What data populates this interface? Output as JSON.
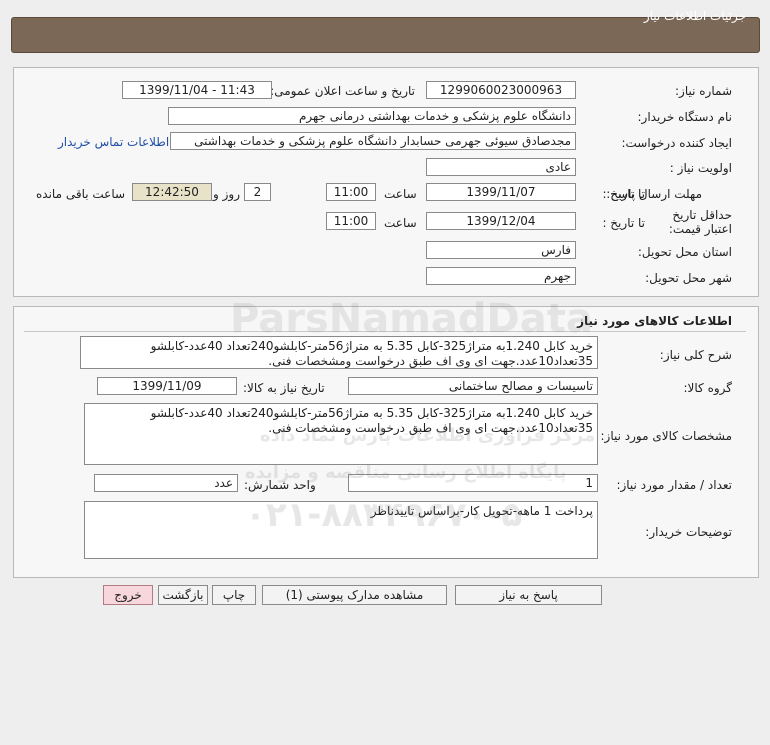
{
  "header": {
    "title": "جزئیات اطلاعات نیاز"
  },
  "details": {
    "need_number_label": "شماره نیاز:",
    "need_number": "1299060023000963",
    "announce_label": "تاریخ و ساعت اعلان عمومی:",
    "announce_value": "1399/11/04 - 11:43",
    "buyer_org_label": "نام دستگاه خریدار:",
    "buyer_org": "دانشگاه علوم پزشکی و خدمات بهداشتی درمانی جهرم",
    "requester_label": "ایجاد کننده درخواست:",
    "requester": "مجدصادق  سیوئی جهرمی حسابدار دانشگاه علوم پزشکی و خدمات بهداشتی",
    "contact_link": "اطلاعات تماس خریدار",
    "priority_label": "اولویت نیاز :",
    "priority": "عادی",
    "reply_deadline_label": "مهلت ارسال پاسخ:",
    "to_date_label": "تا تاریخ :",
    "reply_date": "1399/11/07",
    "time_label": "ساعت",
    "reply_time": "11:00",
    "days_value": "2",
    "days_label": "روز و",
    "remaining_time": "12:42:50",
    "remaining_label": "ساعت باقی مانده",
    "price_validity_label": "حداقل تاریخ اعتبار قیمت:",
    "price_to_date_label": "تا تاریخ :",
    "price_date": "1399/12/04",
    "price_time_label": "ساعت",
    "price_time": "11:00",
    "province_label": "استان محل تحویل:",
    "province": "فارس",
    "city_label": "شهر محل تحویل:",
    "city": "جهرم"
  },
  "goods": {
    "section_title": "اطلاعات کالاهای مورد نیاز",
    "summary_label": "شرح کلی نیاز:",
    "summary": "خرید کابل 1.240به متراژ325-کابل 5.35 به متراژ56متر-کابلشو240تعداد 40عدد-کابلشو 35تعداد10عدد.جهت ای وی اف طبق درخواست ومشخصات فنی.",
    "group_label": "گروه کالا:",
    "group": "تاسیسات و مصالح ساختمانی",
    "need_date_label": "تاریخ نیاز به کالا:",
    "need_date": "1399/11/09",
    "specs_label": "مشخصات کالای مورد نیاز:",
    "specs": "خرید کابل 1.240به متراژ325-کابل 5.35 به متراژ56متر-کابلشو240تعداد 40عدد-کابلشو 35تعداد10عدد.جهت ای وی اف طبق درخواست ومشخصات فنی.",
    "qty_label": "تعداد / مقدار مورد نیاز:",
    "qty": "1",
    "unit_label": "واحد شمارش:",
    "unit": "عدد",
    "buyer_notes_label": "توضیحات خریدار:",
    "buyer_notes": "پرداخت 1 ماهه-تحویل کار-براساس تاییدناظر"
  },
  "buttons": {
    "reply": "پاسخ به نیاز",
    "attachments": "مشاهده مدارک پیوستی (1)",
    "print": "چاپ",
    "back": "بازگشت",
    "exit": "خروج"
  },
  "watermark": {
    "brand": "ParsNamadData",
    "line1": "مرکز فراوری اطلاعات پارس نماد داده",
    "line2": "پایگاه اطلاع رسانی مناقصه و مزایده",
    "phone": "۰۲۱-۸۸۳۴۹۶۷۰-۵"
  },
  "colors": {
    "header_bg": "#7b6857",
    "remaining_bg": "#e8e2c8",
    "exit_bg": "#f7d6dc",
    "link": "#1f4fa8"
  }
}
